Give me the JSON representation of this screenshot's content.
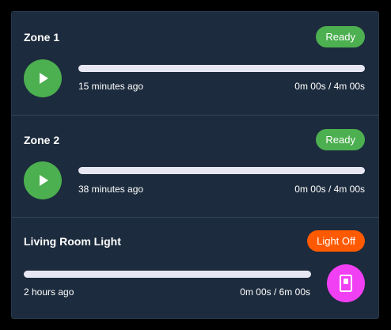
{
  "colors": {
    "panel_bg": "#1c2b3d",
    "ready_badge": "#4caf50",
    "off_badge": "#ff5a00",
    "play_button": "#4caf50",
    "switch_button": "#f13ff3",
    "bar_track": "#e7e7f3"
  },
  "zones": [
    {
      "title": "Zone 1",
      "status": "Ready",
      "last_run": "15 minutes ago",
      "duration": "0m 00s / 4m 00s",
      "progress": 0,
      "icon": "play-icon"
    },
    {
      "title": "Zone 2",
      "status": "Ready",
      "last_run": "38 minutes ago",
      "duration": "0m 00s / 4m 00s",
      "progress": 0,
      "icon": "play-icon"
    }
  ],
  "light": {
    "title": "Living Room Light",
    "status": "Light Off",
    "last_run": "2 hours ago",
    "duration": "0m 00s / 6m 00s",
    "progress": 0,
    "icon": "light-switch-icon"
  }
}
